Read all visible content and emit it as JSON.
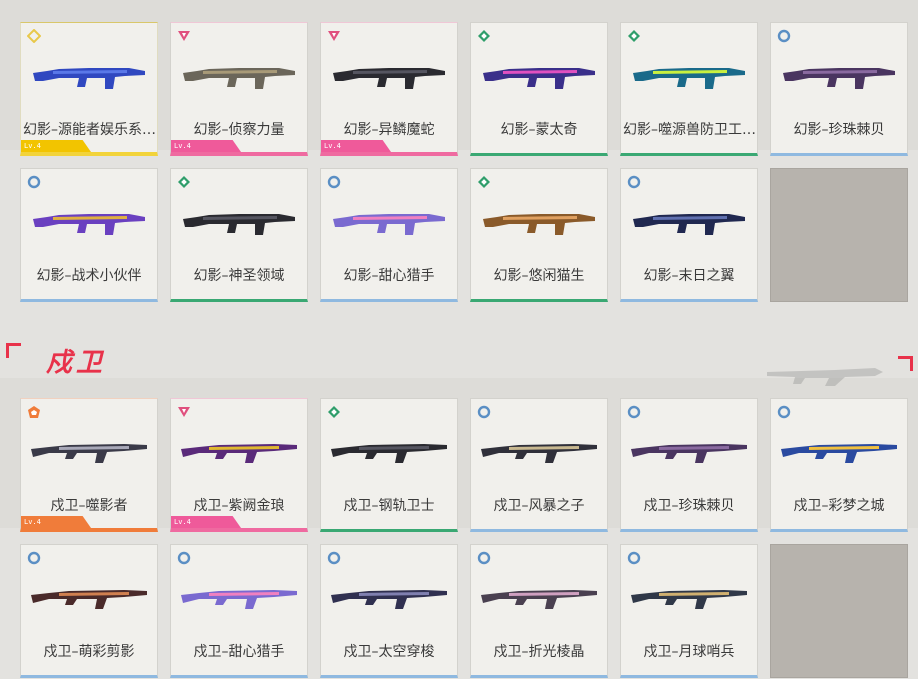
{
  "vandal_section": {
    "cards": [
      {
        "name": "幻影–源能者娱乐系…",
        "rarity": "diamond",
        "rarity_color": "#e8c84a",
        "tag": "Lv.4",
        "tag_color": "yellow",
        "gun": "blue"
      },
      {
        "name": "幻影–侦察力量",
        "rarity": "triangle",
        "rarity_color": "#e0507e",
        "tag": "Lv.4",
        "tag_color": "pink",
        "gun": "tan"
      },
      {
        "name": "幻影–异鳞魔蛇",
        "rarity": "triangle",
        "rarity_color": "#e0507e",
        "tag": "Lv.4",
        "tag_color": "pink",
        "gun": "dark"
      },
      {
        "name": "幻影–蒙太奇",
        "rarity": "hex",
        "rarity_color": "#2f9e6b",
        "gun": "neon"
      },
      {
        "name": "幻影–噬源兽防卫工…",
        "rarity": "hex",
        "rarity_color": "#2f9e6b",
        "gun": "cyan"
      },
      {
        "name": "幻影–珍珠棘贝",
        "rarity": "circle",
        "rarity_color": "#5b8fc4",
        "gun": "purple"
      },
      {
        "name": "幻影–战术小伙伴",
        "rarity": "circle",
        "rarity_color": "#5b8fc4",
        "gun": "lilac"
      },
      {
        "name": "幻影–神圣领域",
        "rarity": "hex",
        "rarity_color": "#2f9e6b",
        "gun": "dark"
      },
      {
        "name": "幻影–甜心猎手",
        "rarity": "circle",
        "rarity_color": "#5b8fc4",
        "gun": "pinkblue"
      },
      {
        "name": "幻影–悠闲猫生",
        "rarity": "hex",
        "rarity_color": "#2f9e6b",
        "gun": "orange"
      },
      {
        "name": "幻影–末日之翼",
        "rarity": "circle",
        "rarity_color": "#5b8fc4",
        "gun": "navy"
      }
    ]
  },
  "guardian_section": {
    "title": "戍卫",
    "cards": [
      {
        "name": "戍卫–噬影者",
        "rarity": "pentagon",
        "rarity_color": "#f07c3a",
        "tag": "Lv.4",
        "tag_color": "orange",
        "gun": "silver"
      },
      {
        "name": "戍卫–紫阙金琅",
        "rarity": "triangle",
        "rarity_color": "#e0507e",
        "tag": "Lv.4",
        "tag_color": "pink",
        "gun": "gold"
      },
      {
        "name": "戍卫–钢轨卫士",
        "rarity": "hex",
        "rarity_color": "#2f9e6b",
        "gun": "dark"
      },
      {
        "name": "戍卫–风暴之子",
        "rarity": "circle",
        "rarity_color": "#5b8fc4",
        "gun": "storm"
      },
      {
        "name": "戍卫–珍珠棘贝",
        "rarity": "circle",
        "rarity_color": "#5b8fc4",
        "gun": "purple"
      },
      {
        "name": "戍卫–彩梦之城",
        "rarity": "circle",
        "rarity_color": "#5b8fc4",
        "gun": "colorful"
      },
      {
        "name": "戍卫–萌彩剪影",
        "rarity": "circle",
        "rarity_color": "#5b8fc4",
        "gun": "brown"
      },
      {
        "name": "戍卫–甜心猎手",
        "rarity": "circle",
        "rarity_color": "#5b8fc4",
        "gun": "pinkblue"
      },
      {
        "name": "戍卫–太空穿梭",
        "rarity": "circle",
        "rarity_color": "#5b8fc4",
        "gun": "space"
      },
      {
        "name": "戍卫–折光棱晶",
        "rarity": "circle",
        "rarity_color": "#5b8fc4",
        "gun": "prism"
      },
      {
        "name": "戍卫–月球哨兵",
        "rarity": "circle",
        "rarity_color": "#5b8fc4",
        "gun": "lunar"
      }
    ]
  },
  "gun_colors": {
    "blue": [
      "#3048c0",
      "#5a78e8"
    ],
    "tan": [
      "#6b665a",
      "#a89a78"
    ],
    "dark": [
      "#2a2a30",
      "#555560"
    ],
    "neon": [
      "#3a2f8a",
      "#e050c0"
    ],
    "cyan": [
      "#1a6a8a",
      "#c8f040"
    ],
    "purple": [
      "#4a3560",
      "#8a6aa0"
    ],
    "lilac": [
      "#6a40c0",
      "#e0b040"
    ],
    "pinkblue": [
      "#7a6ad0",
      "#f080c0"
    ],
    "orange": [
      "#8a5a2a",
      "#e0a060"
    ],
    "navy": [
      "#202850",
      "#6070b0"
    ],
    "silver": [
      "#3a3a48",
      "#a8a8b8"
    ],
    "gold": [
      "#5a2a7a",
      "#e0b830"
    ],
    "storm": [
      "#30303a",
      "#c8b890"
    ],
    "colorful": [
      "#2a4aa0",
      "#f0c040"
    ],
    "brown": [
      "#4a2a2a",
      "#d08050"
    ],
    "space": [
      "#303050",
      "#8080b0"
    ],
    "prism": [
      "#4a4050",
      "#d0a0c0"
    ],
    "lunar": [
      "#303848",
      "#d0b070"
    ]
  }
}
